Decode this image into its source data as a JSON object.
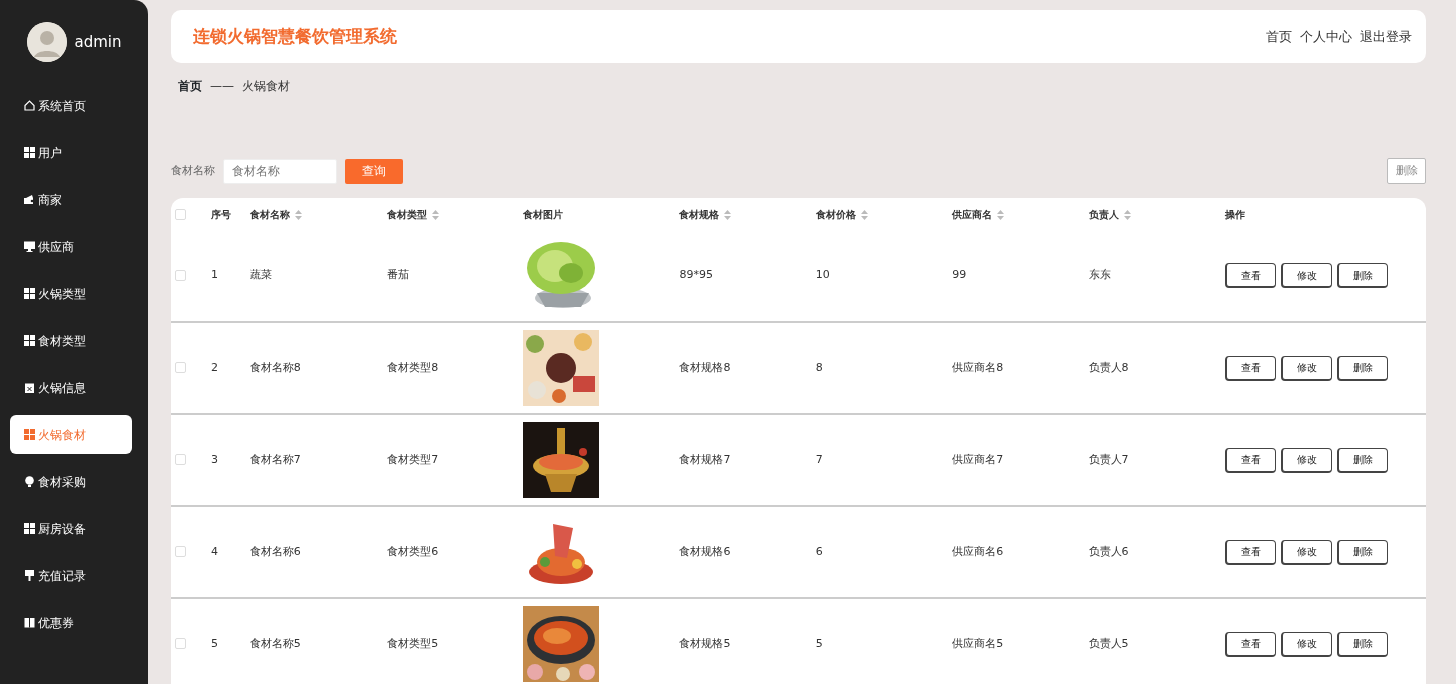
{
  "sidebar": {
    "user": "admin",
    "items": [
      {
        "label": "系统首页",
        "selected": false
      },
      {
        "label": "用户",
        "selected": false
      },
      {
        "label": "商家",
        "selected": false
      },
      {
        "label": "供应商",
        "selected": false
      },
      {
        "label": "火锅类型",
        "selected": false
      },
      {
        "label": "食材类型",
        "selected": false
      },
      {
        "label": "火锅信息",
        "selected": false
      },
      {
        "label": "火锅食材",
        "selected": true
      },
      {
        "label": "食材采购",
        "selected": false
      },
      {
        "label": "厨房设备",
        "selected": false
      },
      {
        "label": "充值记录",
        "selected": false
      },
      {
        "label": "优惠券",
        "selected": false
      }
    ]
  },
  "header": {
    "title": "连锁火锅智慧餐饮管理系统",
    "links": [
      "首页",
      "个人中心",
      "退出登录"
    ]
  },
  "breadcrumb": {
    "home": "首页",
    "separator": "——",
    "current": "火锅食材"
  },
  "search": {
    "label": "食材名称",
    "placeholder": "食材名称",
    "button": "查询",
    "delete_button": "删除"
  },
  "table": {
    "select_all_checked": false,
    "columns": [
      {
        "label": "序号",
        "sortable": false
      },
      {
        "label": "食材名称",
        "sortable": true
      },
      {
        "label": "食材类型",
        "sortable": true
      },
      {
        "label": "食材图片",
        "sortable": false
      },
      {
        "label": "食材规格",
        "sortable": true
      },
      {
        "label": "食材价格",
        "sortable": true
      },
      {
        "label": "供应商名",
        "sortable": true
      },
      {
        "label": "负责人",
        "sortable": true
      },
      {
        "label": "操作",
        "sortable": false
      }
    ],
    "rows": [
      {
        "checked": false,
        "cells": [
          "1",
          "蔬菜",
          "番茄",
          {
            "kind": "picture"
          },
          "89*95",
          "10",
          "99",
          "东东"
        ],
        "actions": [
          "查看",
          "修改",
          "删除"
        ]
      },
      {
        "checked": false,
        "cells": [
          "2",
          "食材名称8",
          "食材类型8",
          {
            "kind": "picture"
          },
          "食材规格8",
          "8",
          "供应商名8",
          "负责人8"
        ],
        "actions": [
          "查看",
          "修改",
          "删除"
        ]
      },
      {
        "checked": false,
        "cells": [
          "3",
          "食材名称7",
          "食材类型7",
          {
            "kind": "picture"
          },
          "食材规格7",
          "7",
          "供应商名7",
          "负责人7"
        ],
        "actions": [
          "查看",
          "修改",
          "删除"
        ]
      },
      {
        "checked": false,
        "cells": [
          "4",
          "食材名称6",
          "食材类型6",
          {
            "kind": "picture"
          },
          "食材规格6",
          "6",
          "供应商名6",
          "负责人6"
        ],
        "actions": [
          "查看",
          "修改",
          "删除"
        ]
      },
      {
        "checked": false,
        "cells": [
          "5",
          "食材名称5",
          "食材类型5",
          {
            "kind": "picture"
          },
          "食材规格5",
          "5",
          "供应商名5",
          "负责人5"
        ],
        "actions": [
          "查看",
          "修改",
          "删除"
        ]
      }
    ]
  }
}
